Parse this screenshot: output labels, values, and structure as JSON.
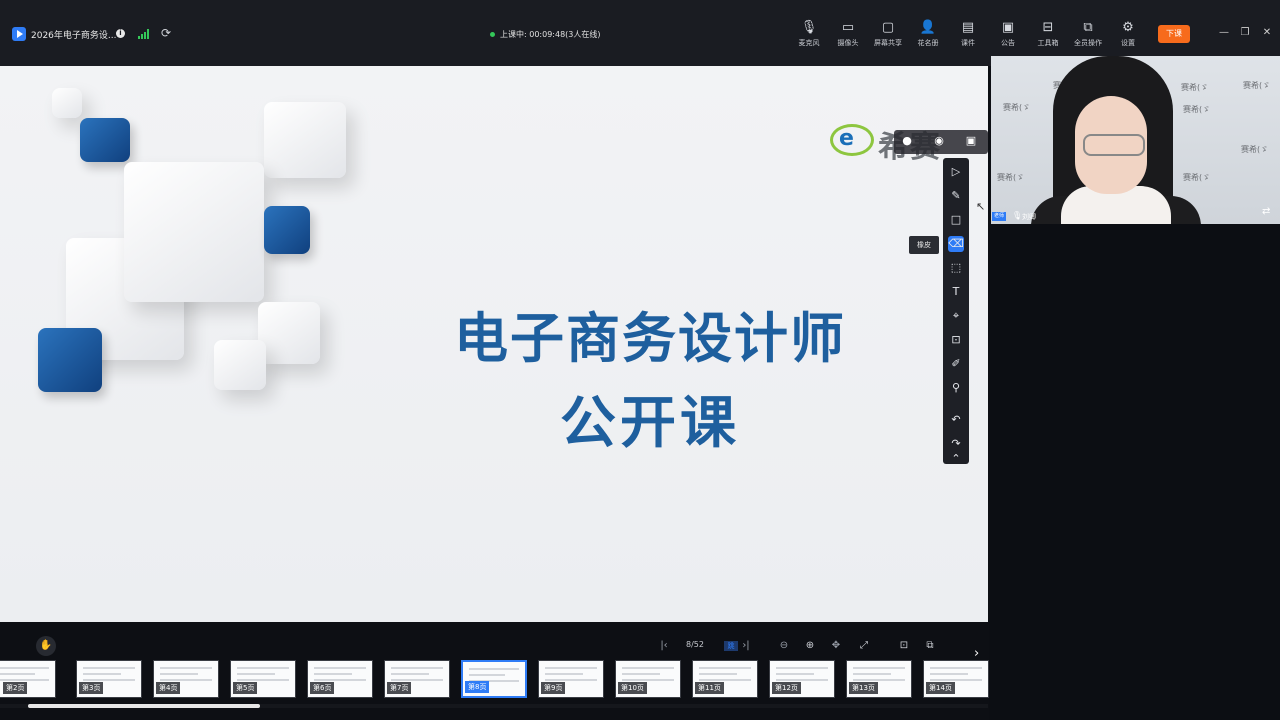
{
  "topbar": {
    "title": "2026年电子商务设...",
    "status": "上课中: 00:09:48(3人在线)",
    "tools": [
      {
        "label": "麦克风",
        "icon": "microphone-icon",
        "glyph": "🎙"
      },
      {
        "label": "摄像头",
        "icon": "camera-icon",
        "glyph": "▭"
      },
      {
        "label": "屏幕共享",
        "icon": "screen-share-icon",
        "glyph": "▢"
      },
      {
        "label": "花名册",
        "icon": "roster-icon",
        "glyph": "👤"
      },
      {
        "label": "课件",
        "icon": "courseware-icon",
        "glyph": "▤"
      },
      {
        "label": "公告",
        "icon": "announcement-icon",
        "glyph": "▣"
      },
      {
        "label": "工具箱",
        "icon": "toolbox-icon",
        "glyph": "⊟"
      },
      {
        "label": "全员操作",
        "icon": "all-members-icon",
        "glyph": "⧉"
      },
      {
        "label": "设置",
        "icon": "gear-icon",
        "glyph": "⚙"
      }
    ],
    "end_class": "下课"
  },
  "slide": {
    "title": "电子商务设计师",
    "subtitle": "公开课",
    "brand": "希赛",
    "brand_mark": "e"
  },
  "draw_toolbar": {
    "tooltip": "橡皮",
    "tools": [
      {
        "name": "select-tool",
        "glyph": "▷"
      },
      {
        "name": "pen-tool",
        "glyph": "✎"
      },
      {
        "name": "shape-tool",
        "glyph": "□"
      },
      {
        "name": "eraser-tool",
        "glyph": "⌫",
        "active": true
      },
      {
        "name": "area-select-tool",
        "glyph": "⬚"
      },
      {
        "name": "text-tool",
        "glyph": "T"
      },
      {
        "name": "laser-pointer-tool",
        "glyph": "⌖"
      },
      {
        "name": "image-tool",
        "glyph": "⊡"
      },
      {
        "name": "ruler-tool",
        "glyph": "✐"
      },
      {
        "name": "stamp-tool",
        "glyph": "⚲"
      },
      {
        "name": "undo-tool",
        "glyph": "↶"
      },
      {
        "name": "redo-tool",
        "glyph": "↷"
      },
      {
        "name": "collapse-tool",
        "glyph": "⌃"
      }
    ]
  },
  "video": {
    "badge": "老师",
    "teacher_name": "刘卿",
    "watermark": "赛希(ゞ"
  },
  "pager": {
    "current": "8/52",
    "goto": "跳"
  },
  "thumbnails": [
    {
      "label": "第2页"
    },
    {
      "label": "第3页"
    },
    {
      "label": "第4页"
    },
    {
      "label": "第5页"
    },
    {
      "label": "第6页"
    },
    {
      "label": "第7页"
    },
    {
      "label": "第8页",
      "active": true
    },
    {
      "label": "第9页"
    },
    {
      "label": "第10页"
    },
    {
      "label": "第11页"
    },
    {
      "label": "第12页"
    },
    {
      "label": "第13页"
    },
    {
      "label": "第14页"
    }
  ],
  "colors": {
    "accent": "#2f7cf6",
    "end_button": "#f76b1c",
    "title_blue": "#1e5f9e",
    "signal_green": "#34c759"
  }
}
